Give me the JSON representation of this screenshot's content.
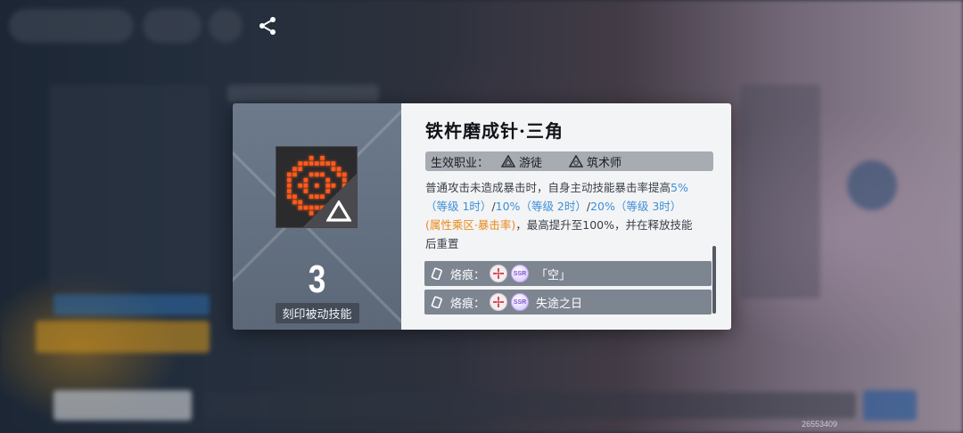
{
  "skill": {
    "title": "铁杵磨成针·三角",
    "level": "3",
    "level_label": "刻印被动技能",
    "jobs_label": "生效职业：",
    "jobs": [
      "游徒",
      "筑术师"
    ]
  },
  "description": {
    "p1": "普通攻击未造成暴击时，自身主动技能暴击率提高",
    "v1": "5%（等级 1时）",
    "s1": "/",
    "v2": "10%（等级 2时）",
    "s2": "/",
    "v3": "20%（等级 3时）",
    "o1": "(属性乘区·暴击率)",
    "p2": "，最高提升至100%，并在释放技能后重置"
  },
  "imprints": [
    {
      "prefix": "烙痕：",
      "name": "「空」",
      "rarity": "SSR"
    },
    {
      "prefix": "烙痕：",
      "name": "失途之日",
      "rarity": "SSR"
    }
  ],
  "uid": "26553409",
  "colors": {
    "accent_blue": "#3d8fd6",
    "accent_orange": "#e98a1a",
    "icon_glow": "#ff5a1c"
  }
}
